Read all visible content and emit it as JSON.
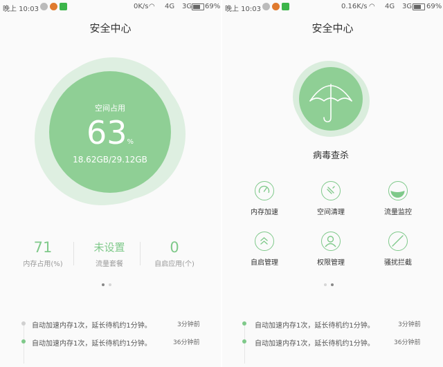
{
  "left": {
    "status": {
      "time": "晚上 10:03",
      "net_speed": "0K/s",
      "signal": "4G",
      "network2": "3G",
      "battery": "69%"
    },
    "title": "安全中心",
    "storage": {
      "label": "空间占用",
      "percent": "63",
      "percent_unit": "%",
      "usage": "18.62GB/29.12GB"
    },
    "stats": [
      {
        "value": "71",
        "label": "内存占用(%)"
      },
      {
        "value": "未设置",
        "label": "流量套餐"
      },
      {
        "value": "0",
        "label": "自启应用(个)"
      }
    ],
    "log": [
      {
        "text": "自动加速内存1次，延长待机约1分钟。",
        "time": "3分钟前"
      },
      {
        "text": "自动加速内存1次，延长待机约1分钟。",
        "time": "36分钟前"
      }
    ]
  },
  "right": {
    "status": {
      "time": "晚上 10:03",
      "net_speed": "0.16K/s",
      "signal": "4G",
      "network2": "3G",
      "battery": "69%"
    },
    "title": "安全中心",
    "virus": {
      "label": "病毒查杀",
      "icon": "umbrella-icon"
    },
    "tools": [
      {
        "label": "内存加速",
        "icon": "speedometer-icon"
      },
      {
        "label": "空间清理",
        "icon": "broom-icon"
      },
      {
        "label": "流量监控",
        "icon": "data-monitor-icon"
      },
      {
        "label": "自启管理",
        "icon": "double-chevron-up-icon"
      },
      {
        "label": "权限管理",
        "icon": "person-icon"
      },
      {
        "label": "骚扰拦截",
        "icon": "block-icon"
      }
    ],
    "log": [
      {
        "text": "自动加速内存1次，延长待机约1分钟。",
        "time": "3分钟前"
      },
      {
        "text": "自动加速内存1次，延长待机约1分钟。",
        "time": "36分钟前"
      }
    ]
  },
  "colors": {
    "accent": "#7fc98a",
    "accent_light": "#cfe9d3",
    "log_dot_inactive": "#d0d0d0",
    "page_dot_active": "#888888",
    "page_dot_inactive": "#d6d6d6"
  }
}
